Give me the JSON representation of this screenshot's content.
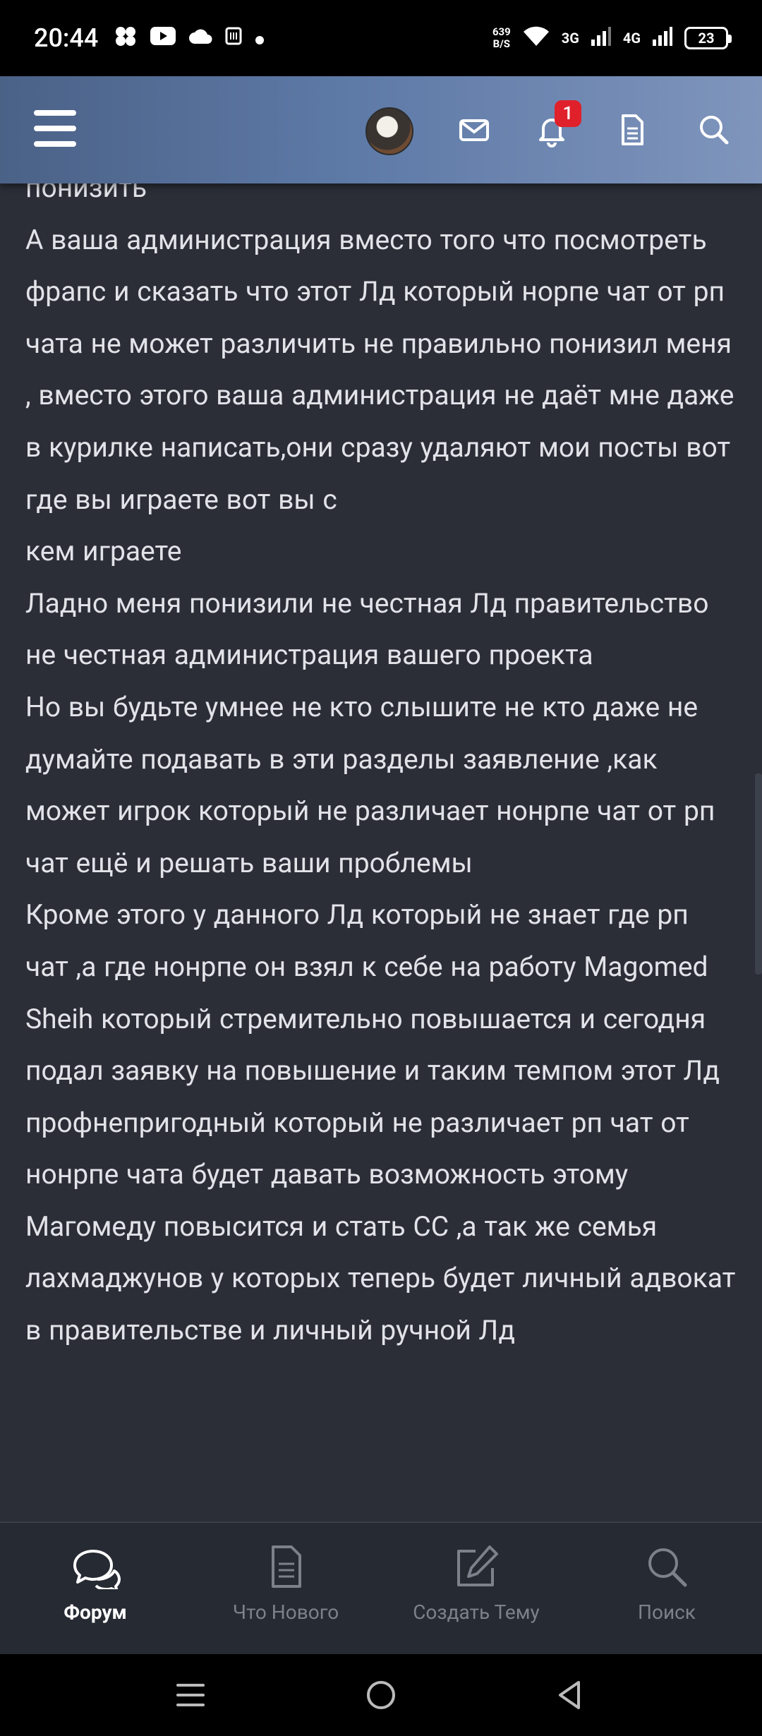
{
  "status_bar": {
    "time": "20:44",
    "net_speed_value": "639",
    "net_speed_unit": "B/S",
    "signal_1": "3G",
    "signal_2": "4G",
    "battery": "23"
  },
  "header": {
    "notification_count": "1"
  },
  "post": {
    "text": "понизить\nА ваша администрация вместо того что посмотреть фрапс и сказать что этот Лд который норпе чат от рп чата не может различить не правильно понизил меня , вместо этого ваша администрация не даёт мне даже в курилке написать,они сразу удаляют мои посты вот где вы играете вот вы с\nкем играете\nЛадно меня понизили не честная Лд правительство не честная администрация вашего проекта\nНо вы будьте умнее не кто слышите не кто даже не думайте подавать в эти разделы заявление ,как может игрок который не различает нонрпе чат от рп чат ещё и решать ваши проблемы\nКроме этого у данного Лд который не знает где рп чат ,а где нонрпе он взял к себе на работу Magomed Sheih который стремительно повышается и сегодня подал заявку на повышение и таким темпом этот Лд профнепригодный который не различает рп чат от нонрпе чата будет давать возможность этому Магомеду повысится и стать СС ,а так же семья лахмаджунов у которых теперь будет личный адвокат в правительстве и личный ручной Лд"
  },
  "bottom_nav": {
    "items": [
      {
        "label": "Форум",
        "icon": "forum-icon",
        "active": true
      },
      {
        "label": "Что Нового",
        "icon": "whats-new-icon",
        "active": false
      },
      {
        "label": "Создать Тему",
        "icon": "create-thread-icon",
        "active": false
      },
      {
        "label": "Поиск",
        "icon": "search-icon",
        "active": false
      }
    ]
  },
  "colors": {
    "background": "#2b2e37",
    "header_gradient_start": "#4b6287",
    "header_gradient_end": "#7f95bc",
    "text": "#e1e3e8",
    "badge": "#e0202a"
  }
}
